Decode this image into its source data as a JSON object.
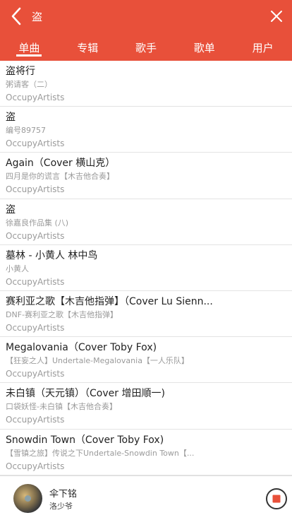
{
  "search": {
    "query": "盗"
  },
  "tabs": [
    {
      "label": "单曲",
      "active": true
    },
    {
      "label": "专辑",
      "active": false
    },
    {
      "label": "歌手",
      "active": false
    },
    {
      "label": "歌单",
      "active": false
    },
    {
      "label": "用户",
      "active": false
    }
  ],
  "songs": [
    {
      "title": "盗将行",
      "album": "粥请客（二）",
      "artist": "OccupyArtists"
    },
    {
      "title": "盗",
      "album": "编号89757",
      "artist": "OccupyArtists"
    },
    {
      "title": "Again（Cover 横山克）",
      "album": "四月是你的谎言【木吉他合奏】",
      "artist": "OccupyArtists"
    },
    {
      "title": "盗",
      "album": "徐嘉良作品集 (八)",
      "artist": "OccupyArtists"
    },
    {
      "title": "墓林 - 小黄人 林中鸟",
      "album": "小黄人",
      "artist": "OccupyArtists"
    },
    {
      "title": "赛利亚之歌【木吉他指弹】（Cover Lu Sienn...",
      "album": "DNF-赛利亚之歌【木吉他指弹】",
      "artist": "OccupyArtists"
    },
    {
      "title": "Megalovania（Cover Toby Fox)",
      "album": "【狂妄之人】Undertale-Megalovania【一人乐队】",
      "artist": "OccupyArtists"
    },
    {
      "title": "未白镇（天元镇）（Cover 增田順一)",
      "album": "口袋妖怪-未白镇【木吉他合奏】",
      "artist": "OccupyArtists"
    },
    {
      "title": "Snowdin Town（Cover Toby Fox)",
      "album": "【雪镇之旅】传说之下Undertale-Snowdin Town【...",
      "artist": "OccupyArtists"
    }
  ],
  "player": {
    "song": "伞下铭",
    "singer": "洛少爷"
  },
  "colors": {
    "brand": "#e8503a",
    "stop": "#e8503a"
  }
}
